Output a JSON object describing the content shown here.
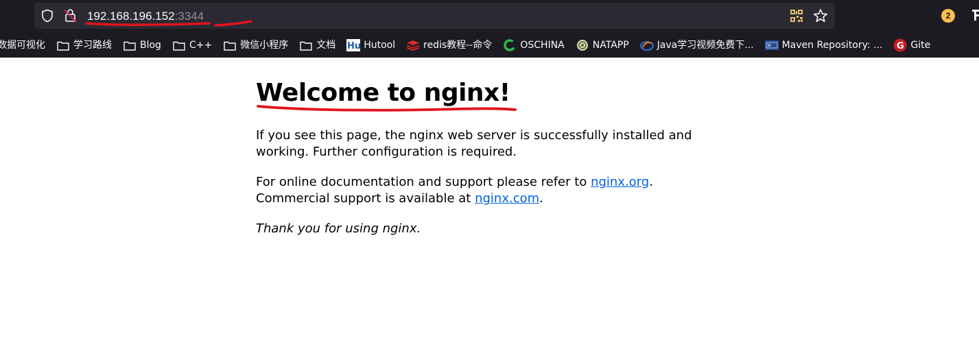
{
  "urlbar": {
    "host": "192.168.196.152",
    "port": ":3344",
    "badge_count": "2"
  },
  "bookmarks": [
    {
      "label": "数据可视化",
      "icon": "folder-icon"
    },
    {
      "label": "学习路线",
      "icon": "folder-icon"
    },
    {
      "label": "Blog",
      "icon": "folder-icon"
    },
    {
      "label": "C++",
      "icon": "folder-icon"
    },
    {
      "label": "微信小程序",
      "icon": "folder-icon"
    },
    {
      "label": "文档",
      "icon": "folder-icon"
    },
    {
      "label": "Hutool",
      "icon": "hutool-icon"
    },
    {
      "label": "redis教程--命令",
      "icon": "redis-icon"
    },
    {
      "label": "OSCHINA",
      "icon": "oschina-icon"
    },
    {
      "label": "NATAPP",
      "icon": "natapp-icon"
    },
    {
      "label": "Java学习视频免费下...",
      "icon": "java-icon"
    },
    {
      "label": "Maven Repository: ...",
      "icon": "maven-icon"
    },
    {
      "label": "Gite",
      "icon": "gitee-icon"
    }
  ],
  "page": {
    "title": "Welcome to nginx!",
    "para1": "If you see this page, the nginx web server is successfully installed and working. Further configuration is required.",
    "para2_a": "For online documentation and support please refer to ",
    "link1": "nginx.org",
    "para2_b": ".",
    "para2_c": "Commercial support is available at ",
    "link2": "nginx.com",
    "para2_d": ".",
    "thanks": "Thank you for using nginx."
  },
  "colors": {
    "chrome_bg": "#1c1b22",
    "urlbar_bg": "#2b2a33",
    "link": "#0060df",
    "annotation_red": "#e0141e",
    "badge": "#ffbd4f"
  }
}
